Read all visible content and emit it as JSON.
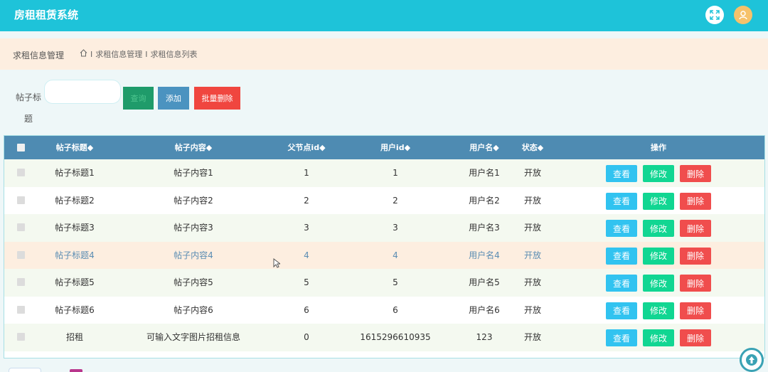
{
  "app": {
    "title": "房租租赁系统",
    "icons": {
      "fullscreen": "fullscreen-icon",
      "user": "user-avatar-icon"
    }
  },
  "breadcrumb": {
    "main": "求租信息管理",
    "path": [
      "求租信息管理",
      "求租信息列表"
    ],
    "separator": "I",
    "home_icon": "home-icon"
  },
  "search": {
    "label": "帖子标题",
    "input_value": "",
    "search_label": "查询",
    "add_label": "添加",
    "batch_delete_label": "批量删除"
  },
  "table": {
    "columns": [
      "帖子标题◆",
      "帖子内容◆",
      "父节点id◆",
      "用户id◆",
      "用户名◆",
      "状态◆",
      "操作"
    ],
    "actions": {
      "view": "查看",
      "edit": "修改",
      "delete": "删除"
    },
    "rows": [
      [
        "帖子标题1",
        "帖子内容1",
        "1",
        "1",
        "用户名1",
        "开放"
      ],
      [
        "帖子标题2",
        "帖子内容2",
        "2",
        "2",
        "用户名2",
        "开放"
      ],
      [
        "帖子标题3",
        "帖子内容3",
        "3",
        "3",
        "用户名3",
        "开放"
      ],
      [
        "帖子标题4",
        "帖子内容4",
        "4",
        "4",
        "用户名4",
        "开放"
      ],
      [
        "帖子标题5",
        "帖子内容5",
        "5",
        "5",
        "用户名5",
        "开放"
      ],
      [
        "帖子标题6",
        "帖子内容6",
        "6",
        "6",
        "用户名6",
        "开放"
      ],
      [
        "招租",
        "可输入文字图片招租信息",
        "0",
        "1615296610935",
        "123",
        "开放"
      ]
    ]
  },
  "colors": {
    "topbar": "#1ec3d9",
    "header": "#4e8bb2",
    "view": "#31c3f0",
    "edit": "#11d692",
    "delete": "#f04d4d",
    "hover_row": "#fdeee0"
  }
}
